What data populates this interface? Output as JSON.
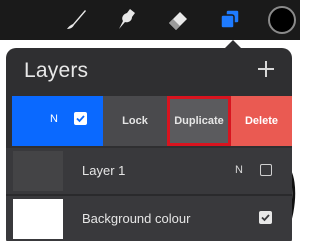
{
  "toolbar": {
    "tools": [
      "brush-icon",
      "smudge-icon",
      "eraser-icon",
      "layers-icon"
    ],
    "color_swatch": "#000000",
    "active_tool_color": "#1e7bff"
  },
  "layers_panel": {
    "title": "Layers",
    "add_icon": "plus-icon",
    "active_layer": {
      "blend_mode": "N",
      "visible": true,
      "color": "#0a69ff"
    },
    "actions": {
      "lock_label": "Lock",
      "duplicate_label": "Duplicate",
      "delete_label": "Delete",
      "delete_color": "#ea5a52",
      "highlight_color": "#d8141f"
    },
    "layers": [
      {
        "name": "Layer 1",
        "blend_mode": "N",
        "visible": false
      },
      {
        "name": "Background colour",
        "visible": true
      }
    ]
  }
}
